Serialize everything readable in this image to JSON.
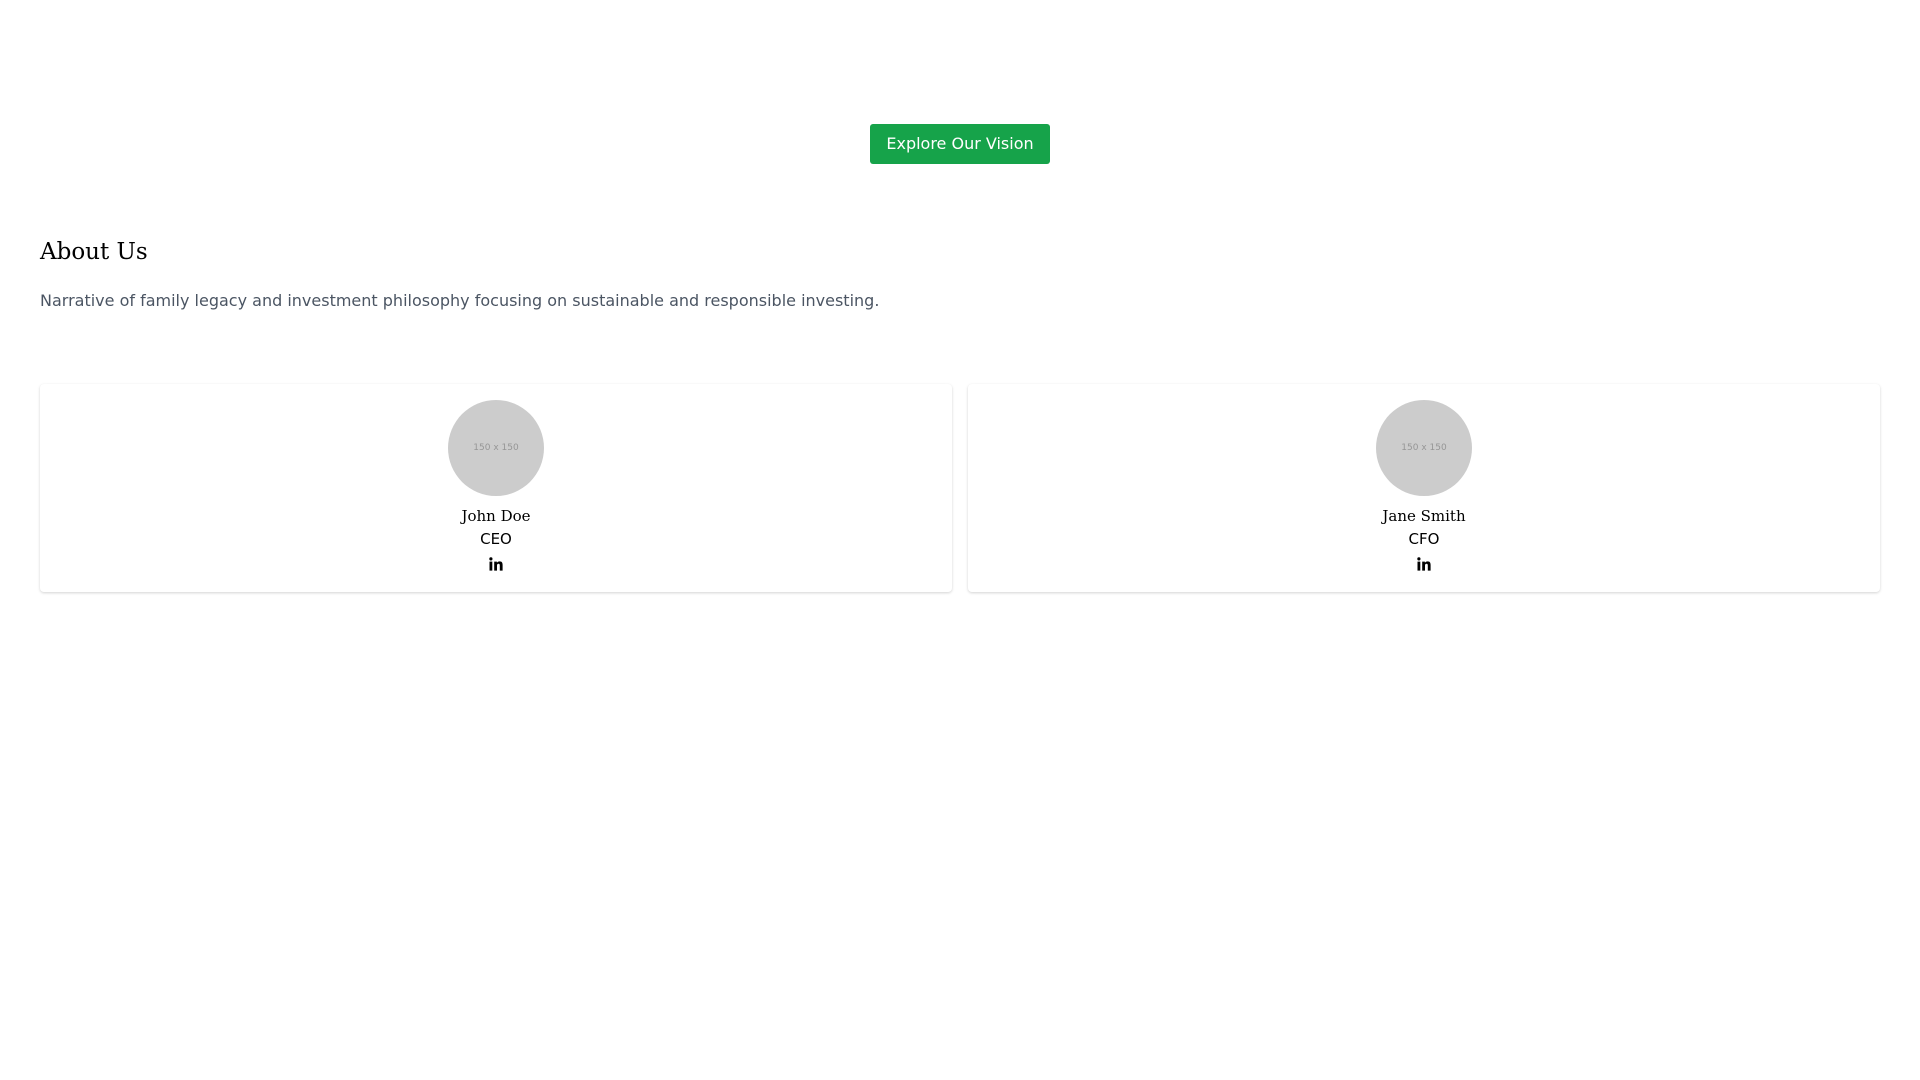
{
  "hero": {
    "cta_label": "Explore Our Vision"
  },
  "about": {
    "title": "About Us",
    "description": "Narrative of family legacy and investment philosophy focusing on sustainable and responsible investing."
  },
  "team": {
    "members": [
      {
        "photo_placeholder": "150 x 150",
        "name": "John Doe",
        "role": "CEO",
        "social_icon": "linkedin-icon"
      },
      {
        "photo_placeholder": "150 x 150",
        "name": "Jane Smith",
        "role": "CFO",
        "social_icon": "linkedin-icon"
      }
    ]
  },
  "colors": {
    "accent": "#16a34a",
    "muted_text": "#4b5563",
    "avatar_placeholder": "#cccccc"
  }
}
